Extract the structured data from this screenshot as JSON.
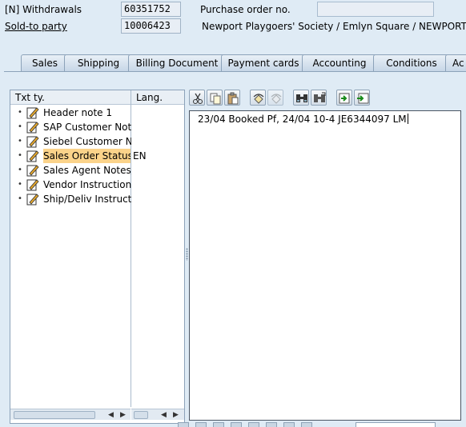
{
  "header": {
    "doc_type_label": "[N] Withdrawals",
    "doc_number": "60351752",
    "po_label": "Purchase order no.",
    "po_value": "",
    "sold_to_label": "Sold-to party",
    "sold_to_number": "10006423",
    "sold_to_name": "Newport Playgoers' Society / Emlyn Square / NEWPORT"
  },
  "tabs": [
    {
      "label": "Sales"
    },
    {
      "label": "Shipping"
    },
    {
      "label": "Billing Document"
    },
    {
      "label": "Payment cards"
    },
    {
      "label": "Accounting"
    },
    {
      "label": "Conditions"
    },
    {
      "label": "Ac"
    }
  ],
  "tree": {
    "col_text_type": "Txt ty.",
    "col_language": "Lang.",
    "items": [
      {
        "label": "Header note 1",
        "lang": ""
      },
      {
        "label": "SAP Customer Note",
        "lang": ""
      },
      {
        "label": "Siebel Customer Note",
        "lang": ""
      },
      {
        "label": "Sales Order Status Note",
        "lang": "EN",
        "selected": true
      },
      {
        "label": "Sales Agent Notes/Instructions",
        "lang": ""
      },
      {
        "label": "Vendor Instructions",
        "lang": ""
      },
      {
        "label": "Ship/Deliv Instructions",
        "lang": ""
      }
    ]
  },
  "toolbar": {
    "icons": [
      "cut-icon",
      "copy-icon",
      "paste-icon",
      "undo-icon",
      "redo-icon",
      "find-icon",
      "find-next-icon",
      "import-icon",
      "export-icon"
    ]
  },
  "editor": {
    "text": "23/04 Booked Pf, 24/04 10-4 JE6344097 LM"
  }
}
